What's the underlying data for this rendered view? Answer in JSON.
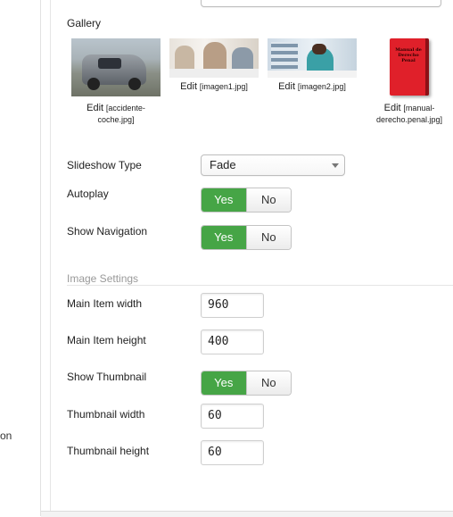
{
  "sidebar": {
    "partial_text": "on"
  },
  "gallery": {
    "label": "Gallery",
    "items": [
      {
        "edit": "Edit",
        "filename": "[accidente-coche.jpg]",
        "filename_line1": "[accidente-",
        "filename_line2": "coche.jpg]"
      },
      {
        "edit": "Edit",
        "filename": "[imagen1.jpg]"
      },
      {
        "edit": "Edit",
        "filename": "[imagen2.jpg]"
      },
      {
        "edit": "Edit",
        "filename": "[manual-derecho.penal.jpg]",
        "filename_line1": "[manual-",
        "filename_line2": "derecho.penal.jpg]",
        "cover_text": "Manual de Derecho Penal"
      }
    ]
  },
  "slideshow_type": {
    "label": "Slideshow Type",
    "value": "Fade"
  },
  "autoplay": {
    "label": "Autoplay",
    "yes": "Yes",
    "no": "No",
    "selected": "Yes"
  },
  "show_navigation": {
    "label": "Show Navigation",
    "yes": "Yes",
    "no": "No",
    "selected": "Yes"
  },
  "image_settings": {
    "legend": "Image Settings"
  },
  "main_item_width": {
    "label": "Main Item width",
    "value": "960"
  },
  "main_item_height": {
    "label": "Main Item height",
    "value": "400"
  },
  "show_thumbnail": {
    "label": "Show Thumbnail",
    "yes": "Yes",
    "no": "No",
    "selected": "Yes"
  },
  "thumbnail_width": {
    "label": "Thumbnail width",
    "value": "60"
  },
  "thumbnail_height": {
    "label": "Thumbnail height",
    "value": "60"
  },
  "colors": {
    "toggle_active": "#46a546",
    "legend_text": "#999999"
  }
}
